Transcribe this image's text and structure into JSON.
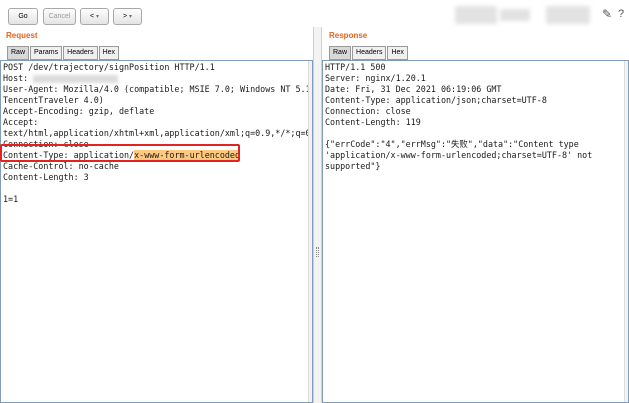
{
  "toolbar": {
    "go_label": "Go",
    "cancel_label": "Cancel",
    "back_label": "<",
    "forward_label": ">",
    "dropdown_caret": "▾"
  },
  "icons": {
    "edit": "pencil-icon",
    "help": "help-icon"
  },
  "request": {
    "title": "Request",
    "tabs": [
      "Raw",
      "Params",
      "Headers",
      "Hex"
    ],
    "active_tab": "Raw",
    "lines": {
      "l1": "POST /dev/trajectory/signPosition HTTP/1.1",
      "l2": "Host:",
      "l3": "User-Agent: Mozilla/4.0 (compatible; MSIE 7.0; Windows NT 5.1;",
      "l4": "TencentTraveler 4.0)",
      "l5": "Accept-Encoding: gzip, deflate",
      "l6": "Accept:",
      "l7": "text/html,application/xhtml+xml,application/xml;q=0.9,*/*;q=0.8",
      "l8": "Connection: close",
      "l9_prefix": "Content-Type: application/",
      "l9_highlight": "x-www-form-urlencoded",
      "l10": "Cache-Control: no-cache",
      "l11": "Content-Length: 3",
      "l12": "",
      "l13": "1=1"
    }
  },
  "response": {
    "title": "Response",
    "tabs": [
      "Raw",
      "Headers",
      "Hex"
    ],
    "active_tab": "Raw",
    "lines": {
      "l1": "HTTP/1.1 500",
      "l2": "Server: nginx/1.20.1",
      "l3": "Date: Fri, 31 Dec 2021 06:19:06 GMT",
      "l4": "Content-Type: application/json;charset=UTF-8",
      "l5": "Connection: close",
      "l6": "Content-Length: 119",
      "l7": "",
      "l8": "{\"errCode\":\"4\",\"errMsg\":\"失败\",\"data\":\"Content type",
      "l9": "'application/x-www-form-urlencoded;charset=UTF-8' not",
      "l10": "supported\"}"
    }
  },
  "colors": {
    "title": "#e8631a",
    "highlight": "#ffc980",
    "annotation_box": "#e32222",
    "editor_border": "#7f9db9"
  }
}
